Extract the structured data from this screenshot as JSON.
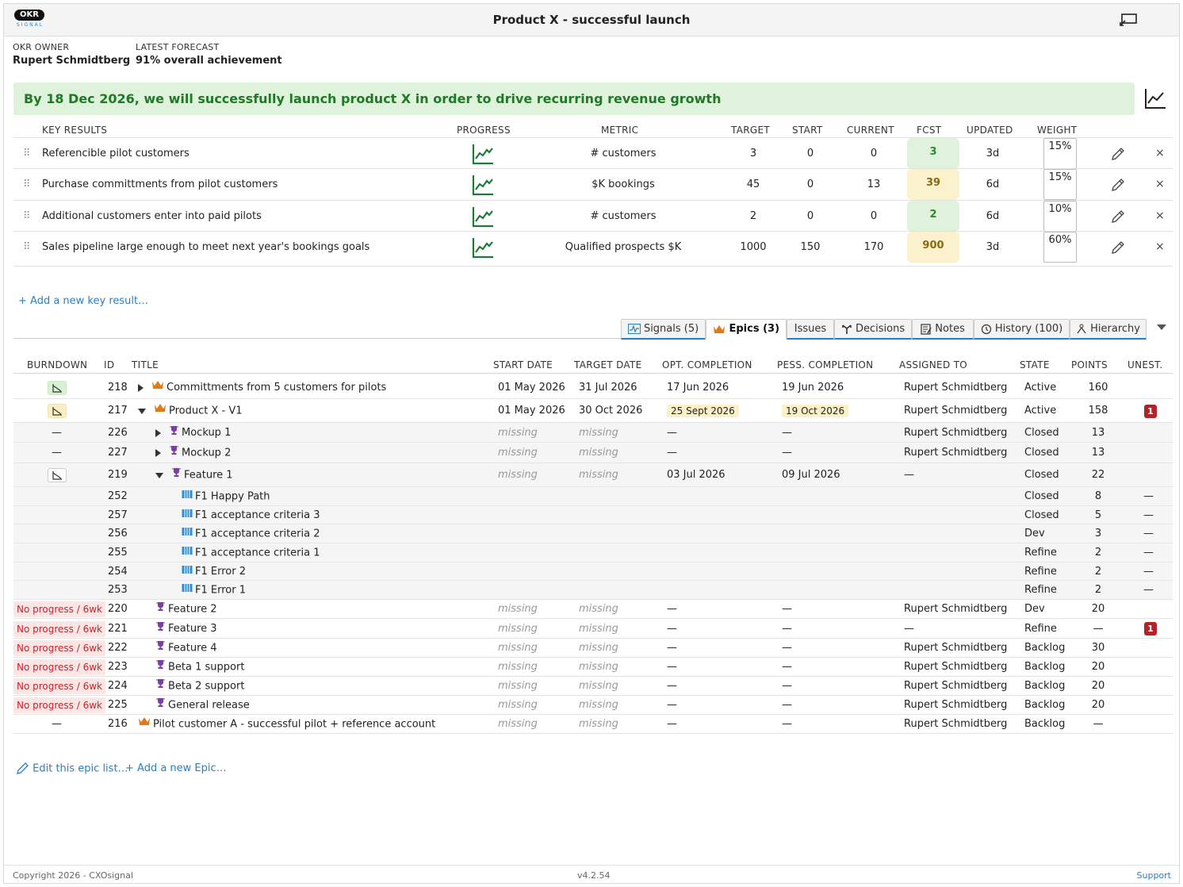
{
  "header": {
    "logo_text": "OKR",
    "logo_sub": "SIGNAL",
    "title": "Product X - successful launch"
  },
  "meta": {
    "owner_label": "OKR OWNER",
    "owner": "Rupert Schmidtberg",
    "forecast_label": "LATEST FORECAST",
    "forecast": "91% overall achievement"
  },
  "objective": "By 18 Dec 2026, we will successfully launch product X in order to drive recurring revenue growth",
  "kr_headers": {
    "key_results": "KEY RESULTS",
    "progress": "PROGRESS",
    "metric": "METRIC",
    "target": "TARGET",
    "start": "START",
    "current": "CURRENT",
    "fcst": "FCST",
    "updated": "UPDATED",
    "weight": "WEIGHT"
  },
  "key_results": [
    {
      "title": "Referencible pilot customers",
      "metric": "# customers",
      "target": "3",
      "start": "0",
      "current": "0",
      "fcst": "3",
      "fcst_color": "green",
      "updated": "3d",
      "weight": "15%"
    },
    {
      "title": "Purchase committments from pilot customers",
      "metric": "$K bookings",
      "target": "45",
      "start": "0",
      "current": "13",
      "fcst": "39",
      "fcst_color": "yellow",
      "updated": "6d",
      "weight": "15%"
    },
    {
      "title": "Additional customers enter into paid pilots",
      "metric": "# customers",
      "target": "2",
      "start": "0",
      "current": "0",
      "fcst": "2",
      "fcst_color": "green",
      "updated": "6d",
      "weight": "10%"
    },
    {
      "title": "Sales pipeline large enough to meet next year's bookings goals",
      "metric": "Qualified prospects $K",
      "target": "1000",
      "start": "150",
      "current": "170",
      "fcst": "900",
      "fcst_color": "yellow",
      "updated": "3d",
      "weight": "60%"
    }
  ],
  "add_kr": "+ Add a new key result…",
  "tabs": [
    {
      "label": "Signals (5)"
    },
    {
      "label": "Epics (3)"
    },
    {
      "label": "Issues"
    },
    {
      "label": "Decisions"
    },
    {
      "label": "Notes"
    },
    {
      "label": "History (100)"
    },
    {
      "label": "Hierarchy"
    }
  ],
  "epic_headers": {
    "burndown": "BURNDOWN",
    "id": "ID",
    "title": "TITLE",
    "start": "START DATE",
    "target": "TARGET DATE",
    "opt": "OPT. COMPLETION",
    "pess": "PESS. COMPLETION",
    "assigned": "ASSIGNED TO",
    "state": "STATE",
    "points": "POINTS",
    "unest": "UNEST."
  },
  "epics": [
    {
      "burndown": "green",
      "id": "218",
      "expander": "right",
      "icon": "crown-icon",
      "title": "Committments from 5 customers for pilots",
      "start": "01 May 2026",
      "target": "31 Jul 2026",
      "opt": "17 Jun 2026",
      "pess": "19 Jun 2026",
      "assigned": "Rupert Schmidtberg",
      "state": "Active",
      "points": "160",
      "unest": ""
    },
    {
      "burndown": "yellow",
      "id": "217",
      "expander": "down",
      "icon": "crown-icon",
      "title": "Product X - V1",
      "start": "01 May 2026",
      "target": "30 Oct 2026",
      "opt": "25 Sept 2026",
      "pess": "19 Oct 2026",
      "assigned": "Rupert Schmidtberg",
      "state": "Active",
      "points": "158",
      "unest": "1"
    },
    {
      "burndown": "—",
      "id": "226",
      "expander": "right",
      "icon": "trophy-icon",
      "title": "Mockup 1",
      "start": "missing",
      "target": "missing",
      "opt": "—",
      "pess": "—",
      "assigned": "Rupert Schmidtberg",
      "state": "Closed",
      "points": "13",
      "unest": ""
    },
    {
      "burndown": "—",
      "id": "227",
      "expander": "right",
      "icon": "trophy-icon",
      "title": "Mockup 2",
      "start": "missing",
      "target": "missing",
      "opt": "—",
      "pess": "—",
      "assigned": "Rupert Schmidtberg",
      "state": "Closed",
      "points": "13",
      "unest": ""
    },
    {
      "burndown": "white",
      "id": "219",
      "expander": "down",
      "icon": "trophy-icon",
      "title": "Feature 1",
      "start": "missing",
      "target": "missing",
      "opt": "03 Jul 2026",
      "pess": "09 Jul 2026",
      "assigned": "—",
      "state": "Closed",
      "points": "22",
      "unest": ""
    },
    {
      "burndown": "",
      "id": "252",
      "expander": "",
      "icon": "story-icon",
      "title": "F1 Happy Path",
      "start": "",
      "target": "",
      "opt": "",
      "pess": "",
      "assigned": "",
      "state": "Closed",
      "points": "8",
      "unest": "—"
    },
    {
      "burndown": "",
      "id": "257",
      "expander": "",
      "icon": "story-icon",
      "title": "F1 acceptance criteria 3",
      "start": "",
      "target": "",
      "opt": "",
      "pess": "",
      "assigned": "",
      "state": "Closed",
      "points": "5",
      "unest": "—"
    },
    {
      "burndown": "",
      "id": "256",
      "expander": "",
      "icon": "story-icon",
      "title": "F1 acceptance criteria 2",
      "start": "",
      "target": "",
      "opt": "",
      "pess": "",
      "assigned": "",
      "state": "Dev",
      "points": "3",
      "unest": "—"
    },
    {
      "burndown": "",
      "id": "255",
      "expander": "",
      "icon": "story-icon",
      "title": "F1 acceptance criteria 1",
      "start": "",
      "target": "",
      "opt": "",
      "pess": "",
      "assigned": "",
      "state": "Refine",
      "points": "2",
      "unest": "—"
    },
    {
      "burndown": "",
      "id": "254",
      "expander": "",
      "icon": "story-icon",
      "title": "F1 Error 2",
      "start": "",
      "target": "",
      "opt": "",
      "pess": "",
      "assigned": "",
      "state": "Refine",
      "points": "2",
      "unest": "—"
    },
    {
      "burndown": "",
      "id": "253",
      "expander": "",
      "icon": "story-icon",
      "title": "F1 Error 1",
      "start": "",
      "target": "",
      "opt": "",
      "pess": "",
      "assigned": "",
      "state": "Refine",
      "points": "2",
      "unest": "—"
    },
    {
      "burndown": "No progress / 6wk",
      "id": "220",
      "expander": "",
      "icon": "trophy-icon",
      "title": "Feature 2",
      "start": "missing",
      "target": "missing",
      "opt": "—",
      "pess": "—",
      "assigned": "Rupert Schmidtberg",
      "state": "Dev",
      "points": "20",
      "unest": ""
    },
    {
      "burndown": "No progress / 6wk",
      "id": "221",
      "expander": "",
      "icon": "trophy-icon",
      "title": "Feature 3",
      "start": "missing",
      "target": "missing",
      "opt": "—",
      "pess": "—",
      "assigned": "—",
      "state": "Refine",
      "points": "—",
      "unest": "1"
    },
    {
      "burndown": "No progress / 6wk",
      "id": "222",
      "expander": "",
      "icon": "trophy-icon",
      "title": "Feature 4",
      "start": "missing",
      "target": "missing",
      "opt": "—",
      "pess": "—",
      "assigned": "Rupert Schmidtberg",
      "state": "Backlog",
      "points": "30",
      "unest": ""
    },
    {
      "burndown": "No progress / 6wk",
      "id": "223",
      "expander": "",
      "icon": "trophy-icon",
      "title": "Beta 1 support",
      "start": "missing",
      "target": "missing",
      "opt": "—",
      "pess": "—",
      "assigned": "Rupert Schmidtberg",
      "state": "Backlog",
      "points": "20",
      "unest": ""
    },
    {
      "burndown": "No progress / 6wk",
      "id": "224",
      "expander": "",
      "icon": "trophy-icon",
      "title": "Beta 2 support",
      "start": "missing",
      "target": "missing",
      "opt": "—",
      "pess": "—",
      "assigned": "Rupert Schmidtberg",
      "state": "Backlog",
      "points": "20",
      "unest": ""
    },
    {
      "burndown": "No progress / 6wk",
      "id": "225",
      "expander": "",
      "icon": "trophy-icon",
      "title": "General release",
      "start": "missing",
      "target": "missing",
      "opt": "—",
      "pess": "—",
      "assigned": "Rupert Schmidtberg",
      "state": "Backlog",
      "points": "20",
      "unest": ""
    },
    {
      "burndown": "—",
      "id": "216",
      "expander": "",
      "icon": "crown-icon",
      "title": "Pilot customer A - successful pilot + reference account",
      "start": "missing",
      "target": "missing",
      "opt": "—",
      "pess": "—",
      "assigned": "Rupert Schmidtberg",
      "state": "Backlog",
      "points": "—",
      "unest": ""
    }
  ],
  "actions": {
    "edit": "Edit this epic list…",
    "add": "+ Add a new Epic…"
  },
  "footer": {
    "copyright": "Copyright 2026 - CXOsignal",
    "version": "v4.2.54",
    "support": "Support"
  },
  "colors": {
    "accent": "#2a7fc2",
    "objective_bg": "#dff3dc",
    "objective_text": "#1e7a24",
    "danger": "#b3232a"
  }
}
